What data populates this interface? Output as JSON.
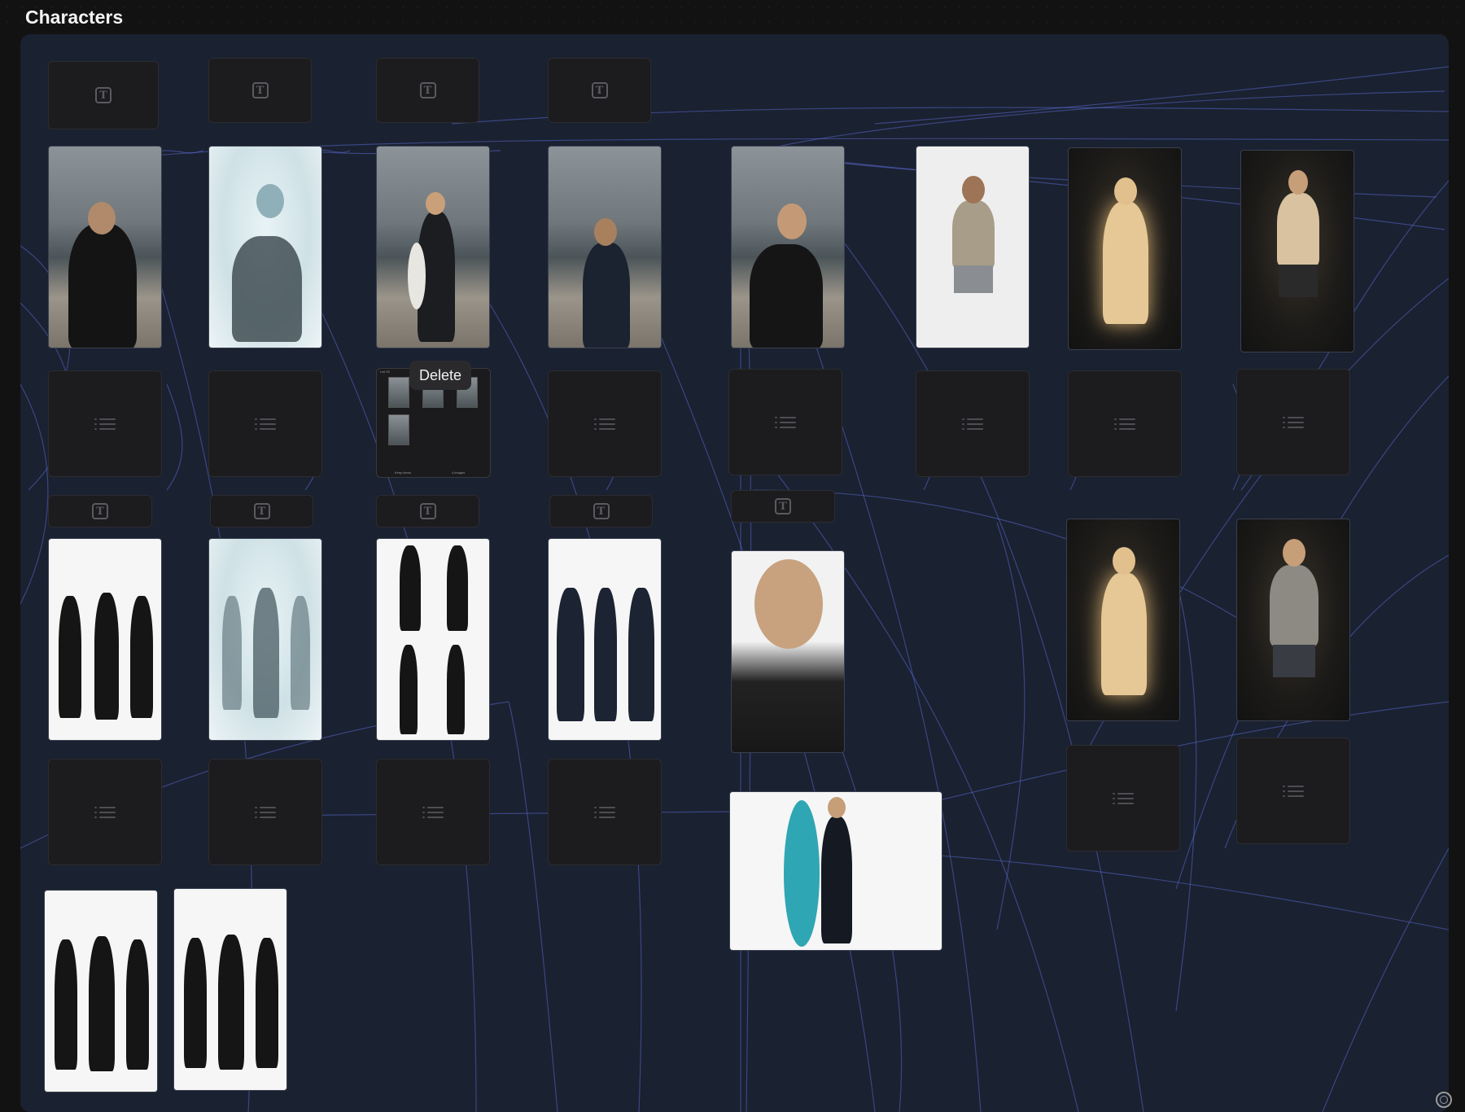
{
  "page": {
    "title": "Characters"
  },
  "tooltip": {
    "label": "Delete"
  },
  "collage": {
    "header": "List 00",
    "footer_left": "Keep items",
    "footer_right": "4 images"
  },
  "icons": {
    "text_node": "text-node-icon",
    "list_node": "list-node-icon",
    "help": "help-lifebuoy-icon"
  },
  "colors": {
    "group_bg": "#1a2130",
    "wire": "#5a6fd8",
    "node_bg": "#1c1c1e",
    "page_bg": "#121212"
  }
}
